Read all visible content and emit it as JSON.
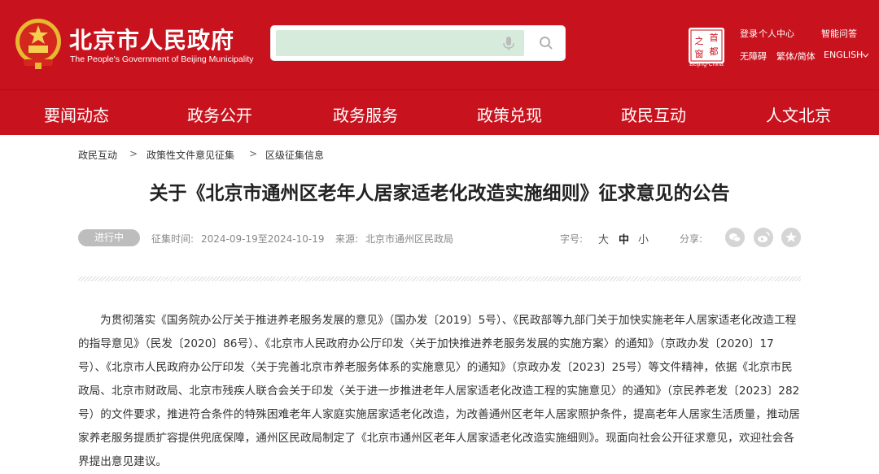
{
  "header": {
    "site_title": "北京市人民政府",
    "site_subtitle": "The People's Government of Beijing Municipality",
    "brand_color": "#c8131e",
    "search": {
      "placeholder": "",
      "value": ""
    },
    "seal_text": [
      "首",
      "之",
      "都",
      "窗"
    ],
    "seal_caption": "Beijing-China",
    "top_links": {
      "login": "登录",
      "personal_center": "个人中心",
      "smart_qa": "智能问答",
      "accessibility": "无障碍",
      "trad_simp": "繁体/简体",
      "english": "ENGLISH"
    }
  },
  "nav": {
    "items": [
      {
        "label": "要闻动态"
      },
      {
        "label": "政务公开"
      },
      {
        "label": "政务服务"
      },
      {
        "label": "政策兑现"
      },
      {
        "label": "政民互动"
      },
      {
        "label": "人文北京"
      }
    ]
  },
  "breadcrumb": {
    "items": [
      "政民互动",
      "政策性文件意见征集",
      "区级征集信息"
    ],
    "separator": ">"
  },
  "article": {
    "title": "关于《北京市通州区老年人居家适老化改造实施细则》征求意见的公告",
    "status": "进行中",
    "period_label": "征集时间:",
    "period": "2024-09-19至2024-10-19",
    "source_label": "来源:",
    "source": "北京市通州区民政局",
    "font_size_label": "字号:",
    "font_sizes": [
      "大",
      "中",
      "小"
    ],
    "share_label": "分享:",
    "share_icons": [
      "wechat-icon",
      "weibo-icon",
      "favorite-icon"
    ],
    "body": "为贯彻落实《国务院办公厅关于推进养老服务发展的意见》（国办发〔2019〕5号）、《民政部等九部门关于加快实施老年人居家适老化改造工程的指导意见》（民发〔2020〕86号）、《北京市人民政府办公厅印发〈关于加快推进养老服务发展的实施方案〉的通知》（京政办发〔2020〕17号）、《北京市人民政府办公厅印发〈关于完善北京市养老服务体系的实施意见〉的通知》（京政办发〔2023〕25号）等文件精神，依据《北京市民政局、北京市财政局、北京市残疾人联合会关于印发〈关于进一步推进老年人居家适老化改造工程的实施意见〉的通知》（京民养老发〔2023〕282号）的文件要求，推进符合条件的特殊困难老年人家庭实施居家适老化改造，为改善通州区老年人居家照护条件，提高老年人居家生活质量，推动居家养老服务提质扩容提供兜底保障，通州区民政局制定了《北京市通州区老年人居家适老化改造实施细则》。现面向社会公开征求意见，欢迎社会各界提出意见建议。"
  }
}
